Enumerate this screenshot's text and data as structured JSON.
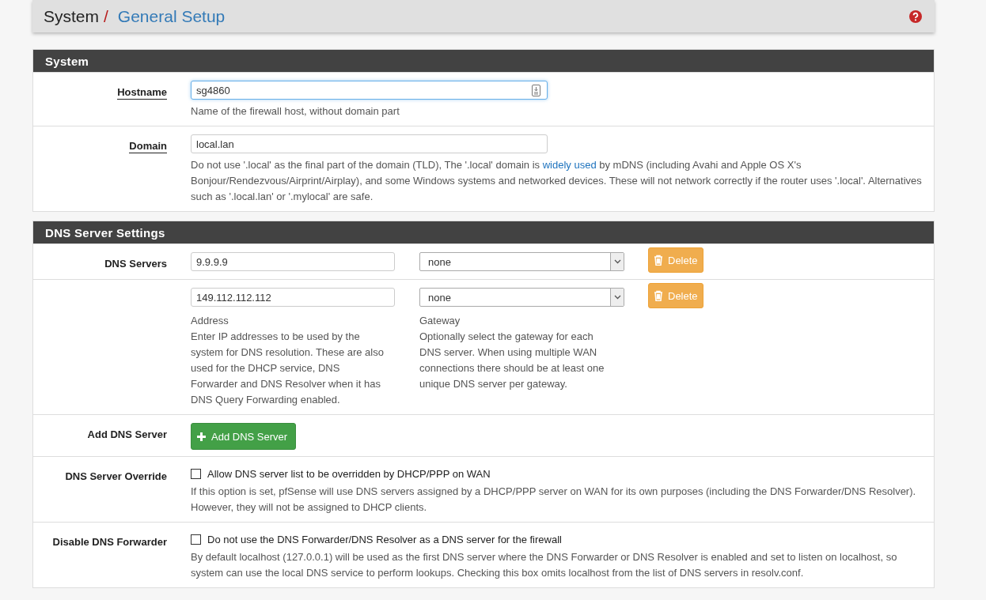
{
  "breadcrumb": {
    "parent": "System",
    "separator": "/",
    "current": "General Setup"
  },
  "sections": [
    {
      "title": "System",
      "rows": [
        {
          "kind": "text",
          "label": "Hostname",
          "has_help": true,
          "value": "sg4860",
          "focused": true,
          "hint": "Name of the firewall host, without domain part"
        },
        {
          "kind": "text",
          "label": "Domain",
          "has_help": true,
          "value": "local.lan",
          "focused": false,
          "hint": "Do not use '.local' as the final part of the domain (TLD), The '.local' domain is ",
          "hint_link": "widely used",
          "hint_after": " by mDNS (including Avahi and Apple OS X's Bonjour/Rendezvous/Airprint/Airplay), and some Windows systems and networked devices. These will not network correctly if the router uses '.local'. Alternatives such as '.local.lan' or '.mylocal' are safe."
        }
      ]
    },
    {
      "title": "DNS Server Settings",
      "rows": [
        {
          "kind": "dns",
          "label": "DNS Servers",
          "address": "9.9.9.9",
          "gateway": "none",
          "button": "Delete"
        },
        {
          "kind": "dns",
          "address": "149.112.112.112",
          "gateway": "none",
          "button": "Delete",
          "address_label": "Address",
          "address_help": "Enter IP addresses to be used by the system for DNS resolution. These are also used for the DHCP service, DNS Forwarder and DNS Resolver when it has DNS Query Forwarding enabled.",
          "gateway_label": "Gateway",
          "gateway_help": "Optionally select the gateway for each DNS server. When using multiple WAN connections there should be at least one unique DNS server per gateway."
        },
        {
          "kind": "add",
          "label": "Add DNS Server",
          "button": "Add DNS Server"
        },
        {
          "kind": "checkbox",
          "label": "DNS Server Override",
          "checked": false,
          "text": "Allow DNS server list to be overridden by DHCP/PPP on WAN",
          "hint": "If this option is set, pfSense will use DNS servers assigned by a DHCP/PPP server on WAN for its own purposes (including the DNS Forwarder/DNS Resolver). However, they will not be assigned to DHCP clients."
        },
        {
          "kind": "checkbox",
          "label": "Disable DNS Forwarder",
          "checked": false,
          "text": "Do not use the DNS Forwarder/DNS Resolver as a DNS server for the firewall",
          "hint": "By default localhost (127.0.0.1) will be used as the first DNS server where the DNS Forwarder or DNS Resolver is enabled and set to listen on localhost, so system can use the local DNS service to perform lookups. Checking this box omits localhost from the list of DNS servers in resolv.conf."
        }
      ]
    }
  ]
}
